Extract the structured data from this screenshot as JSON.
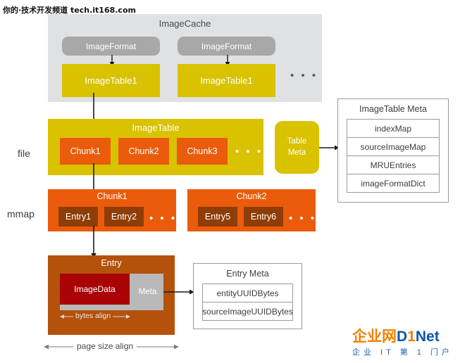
{
  "watermark": "你的·技术开发频道  tech.it168.com",
  "imagecache": {
    "title": "ImageCache",
    "format_left": "ImageFormat",
    "format_right": "ImageFormat",
    "table_left": "ImageTable1",
    "table_right": "ImageTable1",
    "ellipsis": "• • •"
  },
  "layers": {
    "file_label": "file",
    "mmap_label": "mmap"
  },
  "imagetable": {
    "title": "ImageTable",
    "chunks": [
      "Chunk1",
      "Chunk2",
      "Chunk3"
    ],
    "ellipsis": "• • •",
    "table_meta": "Table\nMeta",
    "table_meta_line1": "Table",
    "table_meta_line2": "Meta"
  },
  "imagetable_meta": {
    "title": "ImageTable Meta",
    "rows": [
      "indexMap",
      "sourceImageMap",
      "MRUEntries",
      "imageFormatDict"
    ]
  },
  "chunks_row": [
    {
      "title": "Chunk1",
      "entries": [
        "Entry1",
        "Entry2"
      ],
      "ellipsis": "• • •"
    },
    {
      "title": "Chunk2",
      "entries": [
        "Entry5",
        "Entry6"
      ],
      "ellipsis": "• • •"
    }
  ],
  "entry": {
    "title": "Entry",
    "image_data": "ImageData",
    "meta": "Meta",
    "bytes_align": "bytes align",
    "page_size_align": "page size align"
  },
  "entry_meta": {
    "title": "Entry Meta",
    "rows": [
      "entityUUIDBytes",
      "sourceImageUUIDBytes"
    ]
  },
  "logo": {
    "cn": "企业网",
    "d": "D",
    "one": "1",
    "net": "Net",
    "sub": "企业 IT 第 1 门户"
  },
  "colors": {
    "panel_gray": "#e0e1e2",
    "pill_gray": "#a8a8a8",
    "yellow": "#d9c200",
    "orange": "#ea5b0c",
    "brown": "#b4510a",
    "dark_orange": "#8f3d06",
    "dark_red": "#a90306",
    "meta_gray": "#b9b9b9",
    "stroke": "#9a9a9a",
    "logo_orange": "#f08200",
    "logo_blue": "#0d56a6"
  }
}
